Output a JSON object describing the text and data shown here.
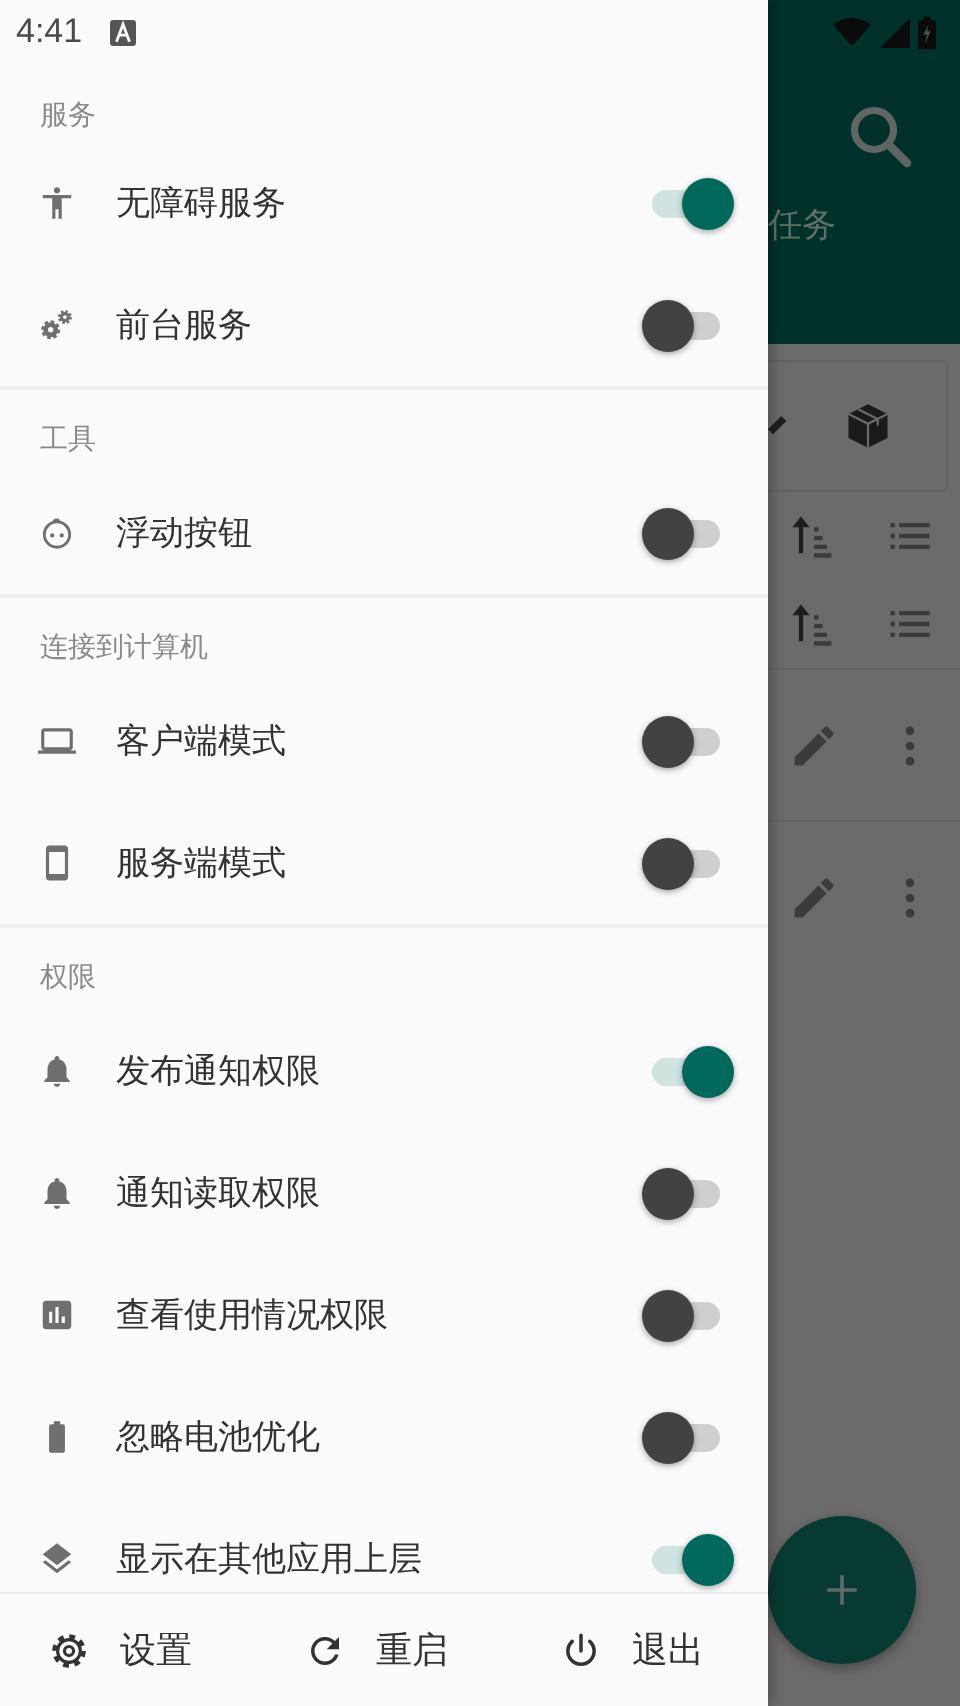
{
  "status_bar": {
    "time": "4:41"
  },
  "drawer": {
    "sections": [
      {
        "title": "服务",
        "items": [
          {
            "label": "无障碍服务",
            "kind": "accessibility",
            "on": true
          },
          {
            "label": "前台服务",
            "kind": "gears",
            "on": false
          }
        ]
      },
      {
        "title": "工具",
        "items": [
          {
            "label": "浮动按钮",
            "kind": "face",
            "on": false
          }
        ]
      },
      {
        "title": "连接到计算机",
        "items": [
          {
            "label": "客户端模式",
            "kind": "laptop",
            "on": false
          },
          {
            "label": "服务端模式",
            "kind": "phone",
            "on": false
          }
        ]
      },
      {
        "title": "权限",
        "items": [
          {
            "label": "发布通知权限",
            "kind": "bell",
            "on": true
          },
          {
            "label": "通知读取权限",
            "kind": "bell",
            "on": false
          },
          {
            "label": "查看使用情况权限",
            "kind": "chart",
            "on": false
          },
          {
            "label": "忽略电池优化",
            "kind": "battery",
            "on": false
          },
          {
            "label": "显示在其他应用上层",
            "kind": "layers",
            "on": true
          }
        ]
      }
    ],
    "footer": [
      {
        "label": "设置",
        "kind": "settings"
      },
      {
        "label": "重启",
        "kind": "refresh"
      },
      {
        "label": "退出",
        "kind": "power"
      }
    ]
  },
  "background_app": {
    "tab_label": "任务"
  }
}
